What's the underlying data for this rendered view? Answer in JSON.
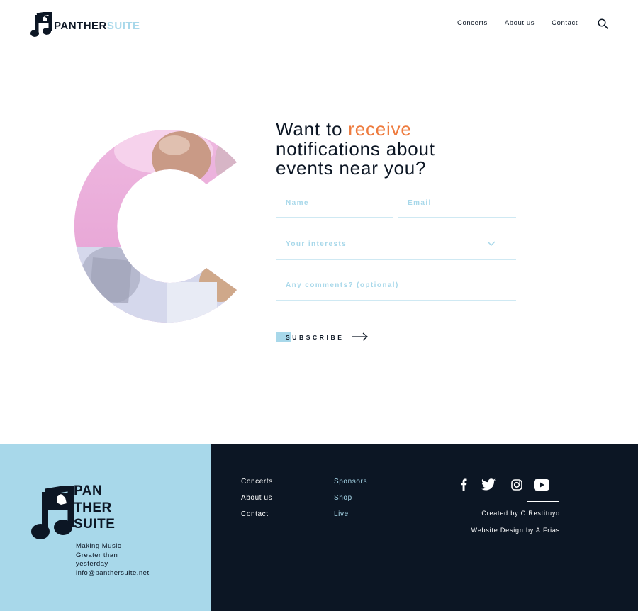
{
  "header": {
    "logo": {
      "part1": "PANTHER",
      "part2": "SUITE"
    },
    "nav": [
      {
        "label": "Concerts"
      },
      {
        "label": "About us"
      },
      {
        "label": "Contact"
      }
    ],
    "search_icon": "search-icon"
  },
  "hero": {
    "headline_pre": "Want to ",
    "headline_accent": "receive",
    "headline_line2": "notifications about",
    "headline_line3": "events near you?",
    "fields": {
      "name_placeholder": "Name",
      "email_placeholder": "Email",
      "interests_placeholder": "Your interests",
      "comments_placeholder": "Any comments? (optional)"
    },
    "subscribe_label": "SUBSCRIBE"
  },
  "footer": {
    "logo_lines": [
      "PAN",
      "THER",
      "SUITE"
    ],
    "tagline": [
      "Making Music",
      "Greater than",
      "yesterday",
      "info@panthersuite.net"
    ],
    "col1": [
      {
        "label": "Concerts"
      },
      {
        "label": "About us"
      },
      {
        "label": "Contact"
      }
    ],
    "col2": [
      {
        "label": "Sponsors"
      },
      {
        "label": "Shop"
      },
      {
        "label": "Live"
      }
    ],
    "social_icons": [
      "facebook-icon",
      "twitter-icon",
      "instagram-icon",
      "youtube-icon"
    ],
    "credit_created": "Created by C.Restituyo",
    "credit_design": "Website Design by A.Frias"
  },
  "colors": {
    "navy": "#0c1624",
    "light_blue": "#a8d8ea",
    "accent_orange": "#ee7b3e",
    "pink": "#e6a6d6"
  }
}
